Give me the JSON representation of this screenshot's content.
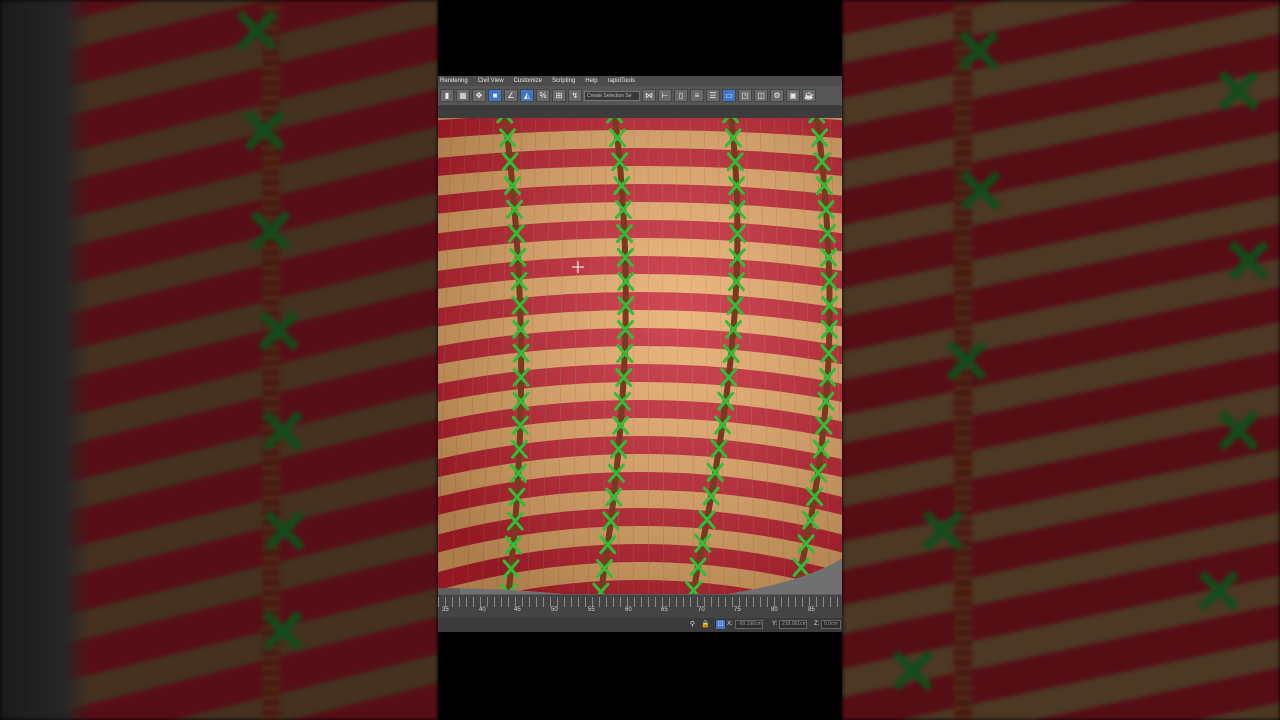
{
  "menu": [
    "Rendering",
    "Civil View",
    "Customize",
    "Scripting",
    "Help",
    "rapidTools"
  ],
  "toolbar": {
    "selection_filter": "Create Selection Se",
    "icons": [
      "select-object-icon",
      "select-region-icon",
      "move-icon",
      "snap-icon",
      "angle-snap-icon",
      "percent-snap-icon",
      "spinner-snap-icon",
      "edit-named-selection-icon",
      "mirror-icon",
      "align-icon",
      "layer-icon",
      "ribbon-icon",
      "curve-editor-icon",
      "schematic-icon",
      "material-editor-icon",
      "render-setup-icon",
      "render-frame-icon",
      "render-icon"
    ]
  },
  "timeline": {
    "ticks": [
      "35",
      "40",
      "45",
      "50",
      "55",
      "60",
      "65",
      "70",
      "75",
      "80",
      "85"
    ]
  },
  "status": {
    "x_label": "X:",
    "x_value": "-99.196cm",
    "y_label": "Y:",
    "y_value": "218.061cm",
    "z_label": "Z:",
    "z_value": "0.0cm"
  },
  "colors": {
    "stripe_red": "#c4202f",
    "stripe_tan": "#e7a865",
    "stitch_green": "#2fbf35",
    "strap_brown": "#7a3a22"
  }
}
